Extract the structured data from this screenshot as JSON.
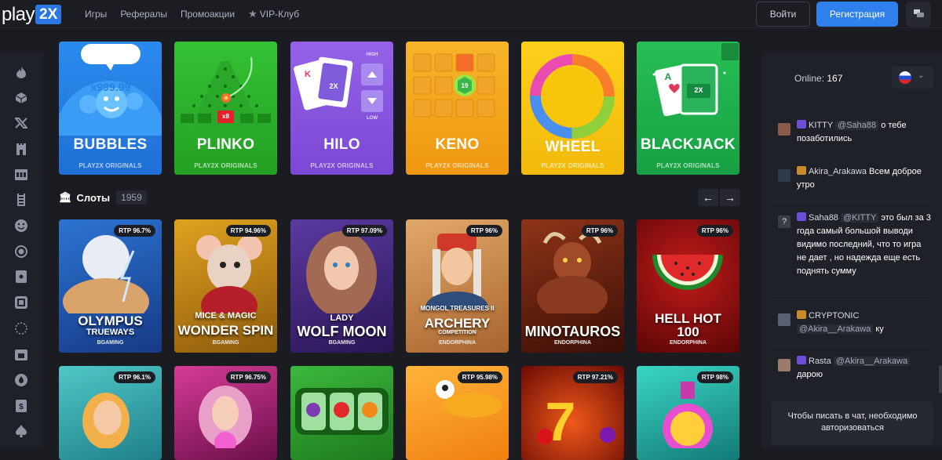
{
  "header": {
    "logo_text": "play",
    "logo_badge": "2X",
    "nav": [
      "Игры",
      "Рефералы",
      "Промоакции",
      "VIP-Клуб"
    ],
    "login_label": "Войти",
    "register_label": "Регистрация",
    "accent": "#2f80ed"
  },
  "sidebar": {
    "icons": [
      "fire-icon",
      "cube-icon",
      "x-logo-icon",
      "castle-icon",
      "slot-machine-icon",
      "ladder-icon",
      "smiley-icon",
      "target-icon",
      "card-icon",
      "dice-icon",
      "roulette-icon",
      "calendar-icon",
      "drop-icon",
      "coin-icon",
      "spade-icon"
    ]
  },
  "originals": [
    {
      "name": "BUBBLES",
      "sub": "PLAY2X ORIGINALS",
      "extra": "x999.99",
      "color": "#2c87e8"
    },
    {
      "name": "PLINKO",
      "sub": "PLAY2X ORIGINALS",
      "extra": "x8",
      "color": "#2fb52f"
    },
    {
      "name": "HILO",
      "sub": "PLAY2X ORIGINALS",
      "extra": "2X",
      "extra2": "HIGH",
      "extra3": "LOW",
      "color": "#8b57df"
    },
    {
      "name": "KENO",
      "sub": "PLAY2X ORIGINALS",
      "extra": "19",
      "color": "#f4a51b"
    },
    {
      "name": "WHEEL",
      "sub": "PLAY2X ORIGINALS",
      "color": "#f7c90d"
    },
    {
      "name": "BLACKJACK",
      "sub": "PLAY2X ORIGINALS",
      "extra": "2X",
      "extra2": "A",
      "color": "#1fb44c"
    }
  ],
  "slots_section": {
    "label": "Слоты",
    "count": "1959"
  },
  "slots": [
    {
      "rtp": "RTP 96.7%",
      "title1": "OLYMPUS",
      "title2": "TRUEWAYS",
      "provider": "BGAMING",
      "color": "#1f5ab5"
    },
    {
      "rtp": "RTP 94.96%",
      "title1": "MICE & MAGIC",
      "title2": "WONDER SPIN",
      "provider": "BGAMING",
      "color": "#c28a13"
    },
    {
      "rtp": "RTP 97.09%",
      "title1": "LADY",
      "title2": "WOLF MOON",
      "provider": "BGAMING",
      "color": "#4a2e86"
    },
    {
      "rtp": "RTP 96%",
      "title1": "MONGOL TREASURES II",
      "title2": "ARCHERY",
      "title3": "COMPETITION",
      "provider": "ENDORPHINA",
      "color": "#c8874a"
    },
    {
      "rtp": "RTP 96%",
      "title1": "",
      "title2": "MINOTAUROS",
      "provider": "ENDORPHINA",
      "color": "#7a2a14"
    },
    {
      "rtp": "RTP 96%",
      "title1": "HELL HOT",
      "title2": "100",
      "provider": "ENDORPHINA",
      "color": "#8c0f0f"
    }
  ],
  "slots_row2": [
    {
      "rtp": "RTP 96.1%",
      "color": "#3bb2b5"
    },
    {
      "rtp": "RTP 96.75%",
      "color": "#b0257a"
    },
    {
      "rtp": "",
      "color": "#2e9d2e"
    },
    {
      "rtp": "RTP 95.98%",
      "color": "#e67e1c"
    },
    {
      "rtp": "RTP 97.21%",
      "color": "#b0160f"
    },
    {
      "rtp": "RTP 98%",
      "color": "#1fa89a"
    }
  ],
  "chat": {
    "online_label": "Online:",
    "online_count": "167",
    "messages": [
      {
        "nick": "KITTY",
        "mention": "@Saha88",
        "text": "о тебе позаботились",
        "badge": "#6b4fd8"
      },
      {
        "nick": "Akira_Arakawa",
        "mention": "",
        "text": "Всем доброе утро",
        "badge": "#c98a2a"
      },
      {
        "nick": "Saha88",
        "mention": "@KITTY",
        "text": "это был за 3 года самый большой выводи видимо последний, что то игра не дает , но надежда еще есть поднять сумму",
        "badge": "#6b4fd8"
      },
      {
        "nick": "CRYPTONIC",
        "mention": "@Akira__Arakawa",
        "text": "ку",
        "badge": "#c98a2a"
      },
      {
        "nick": "Rasta",
        "mention": "@Akira__Arakawa",
        "text": "дарою",
        "badge": "#6b4fd8"
      }
    ],
    "footer": "Чтобы писать в чат, необходимо авторизоваться"
  }
}
